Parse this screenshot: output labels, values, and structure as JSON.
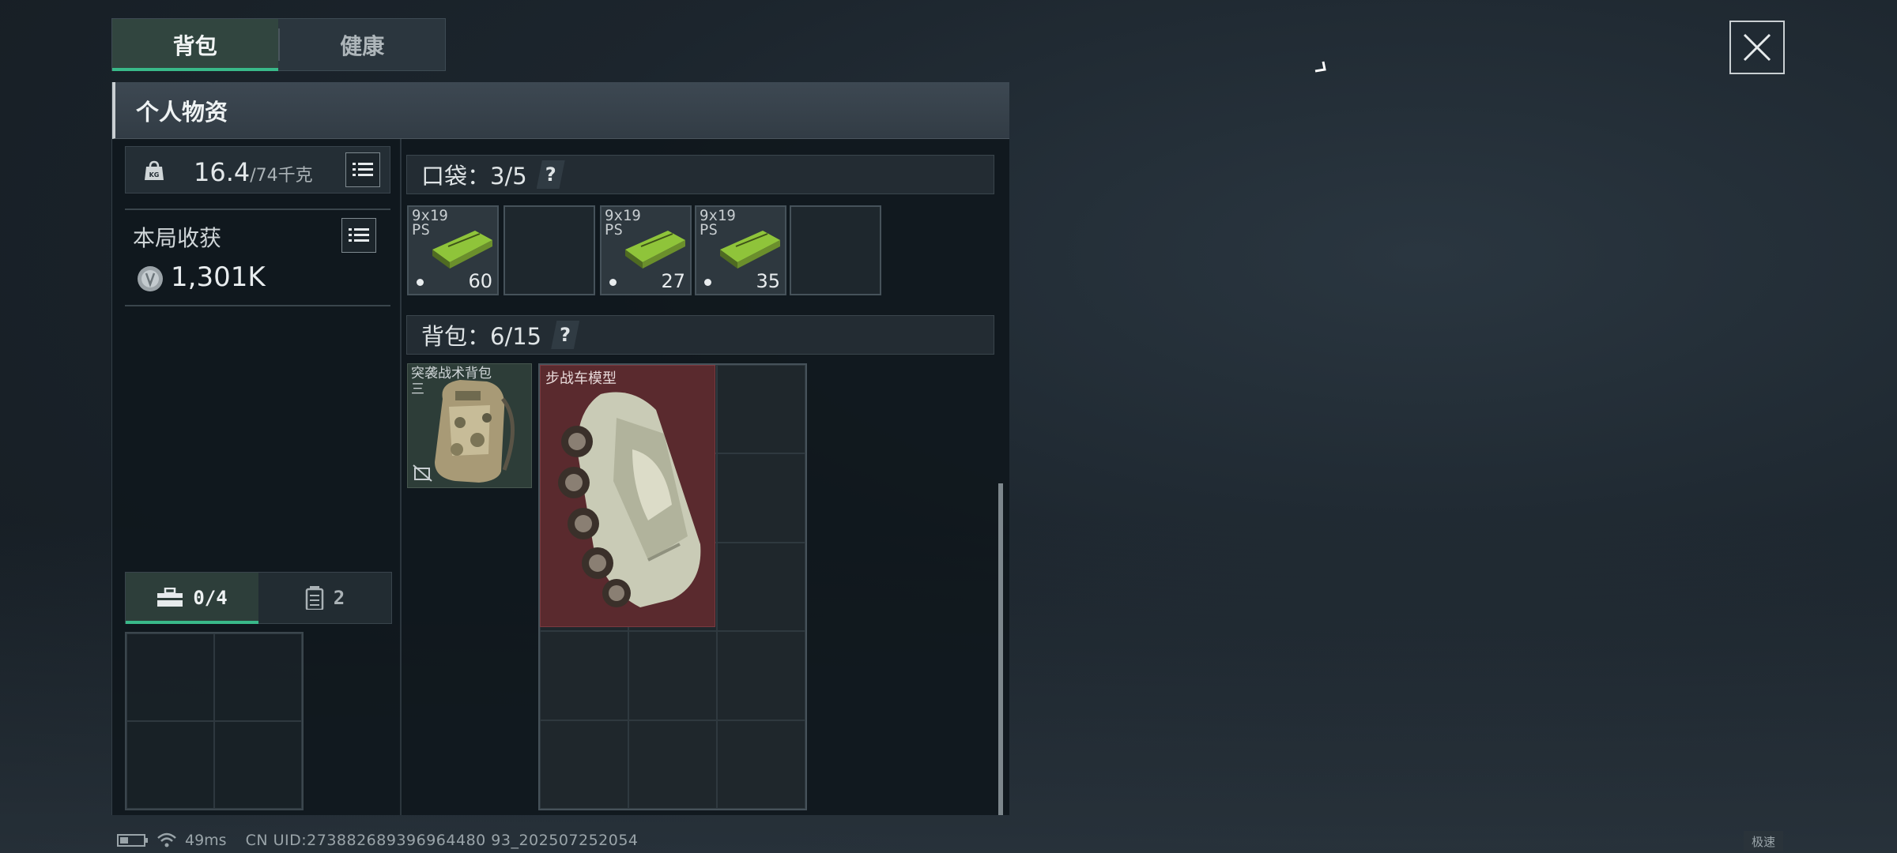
{
  "tabs": [
    {
      "label": "背包",
      "active": true
    },
    {
      "label": "健康",
      "active": false
    }
  ],
  "panel": {
    "title": "个人物资"
  },
  "weight": {
    "current": "16.4",
    "max": "/74千克"
  },
  "harvest": {
    "title": "本局收获",
    "value": "1,301K"
  },
  "sub_tabs": [
    {
      "label": "0/4",
      "icon": "toolbox-icon",
      "active": true
    },
    {
      "label": "2",
      "icon": "canister-icon",
      "active": false
    }
  ],
  "pocket": {
    "label": "口袋：3/5",
    "help": "?"
  },
  "pocket_slots": [
    {
      "name": "9x19\nPS",
      "qty": "60"
    },
    null,
    {
      "name": "9x19\nPS",
      "qty": "27"
    },
    {
      "name": "9x19\nPS",
      "qty": "35"
    },
    null
  ],
  "backpack": {
    "label": "背包：6/15",
    "help": "?"
  },
  "backpack_item": {
    "name": "突袭战术背包\n三"
  },
  "vehicle_item": {
    "name": "步战车模型"
  },
  "status": {
    "ping": "49ms",
    "uid": "CN UID:273882689396964480 93_202507252054",
    "speed_label": "极速"
  },
  "colors": {
    "accent": "#39b989",
    "vehicle_bg": "#5a2a2e",
    "ammo_green": "#8fc43a"
  }
}
